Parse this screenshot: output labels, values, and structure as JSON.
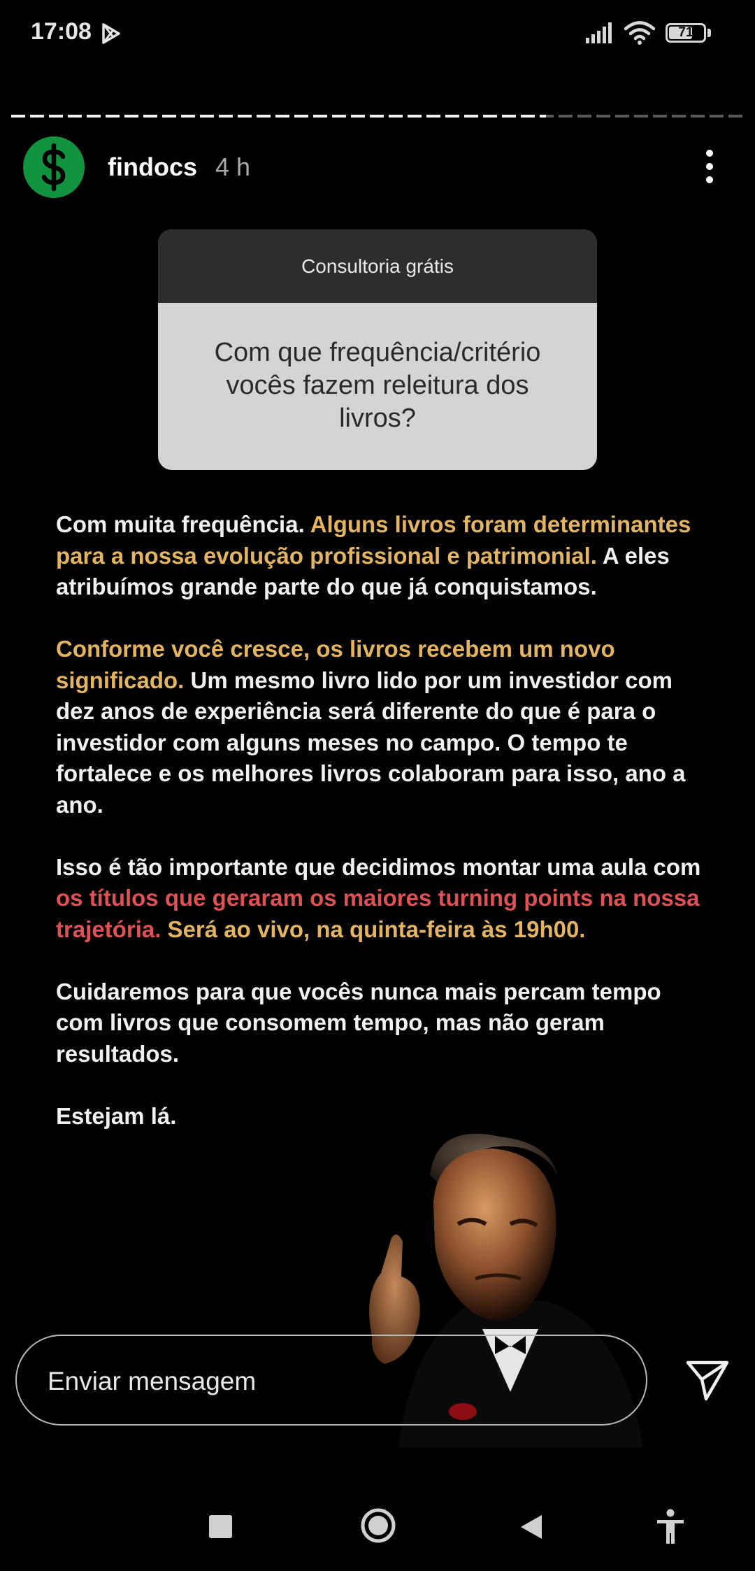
{
  "status_bar": {
    "time": "17:08",
    "battery": "71",
    "battery_level": 0.71,
    "icons": [
      "play-store-icon",
      "signal-icon",
      "wifi-icon",
      "battery-icon"
    ]
  },
  "story": {
    "progress": 0.73,
    "username": "findocs",
    "time_ago": "4 h",
    "question_box": {
      "header": "Consultoria grátis",
      "question": "Com que frequência/critério vocês fazem releitura dos livros?"
    },
    "paragraphs": [
      [
        {
          "text": "Com muita frequência. ",
          "color": "white"
        },
        {
          "text": "Alguns livros foram determinantes para a nossa evolução profissional e patrimonial.",
          "color": "gold"
        },
        {
          "text": " A eles atribuímos grande parte do que já conquistamos.",
          "color": "white"
        }
      ],
      [
        {
          "text": "Conforme você cresce, os livros recebem um novo significado.",
          "color": "gold"
        },
        {
          "text": " Um mesmo livro lido por um investidor com dez anos de experiência será diferente do que é para o investidor com alguns  meses no campo. O tempo te fortalece e os melhores livros colaboram para isso, ano a ano.",
          "color": "white"
        }
      ],
      [
        {
          "text": "Isso é tão importante que decidimos montar uma aula com ",
          "color": "white"
        },
        {
          "text": "os títulos que geraram os maiores turning points na nossa trajetória.",
          "color": "red"
        },
        {
          "text": " Será ao vivo, na quinta-feira às 19h00.",
          "color": "gold"
        }
      ],
      [
        {
          "text": "Cuidaremos para que vocês nunca mais percam tempo com livros que consomem tempo, mas não geram resultados.",
          "color": "white"
        }
      ],
      [
        {
          "text": "Estejam lá.",
          "color": "white"
        }
      ]
    ],
    "image": "portrait-photo"
  },
  "reply": {
    "placeholder": "Enviar mensagem",
    "send_icon": "send-icon"
  },
  "nav_bar": {
    "icons": [
      "recents-icon",
      "home-icon",
      "back-icon",
      "accessibility-icon"
    ]
  },
  "colors": {
    "gold": "#e3b462",
    "red": "#e05155",
    "avatar_green": "#12933f"
  }
}
